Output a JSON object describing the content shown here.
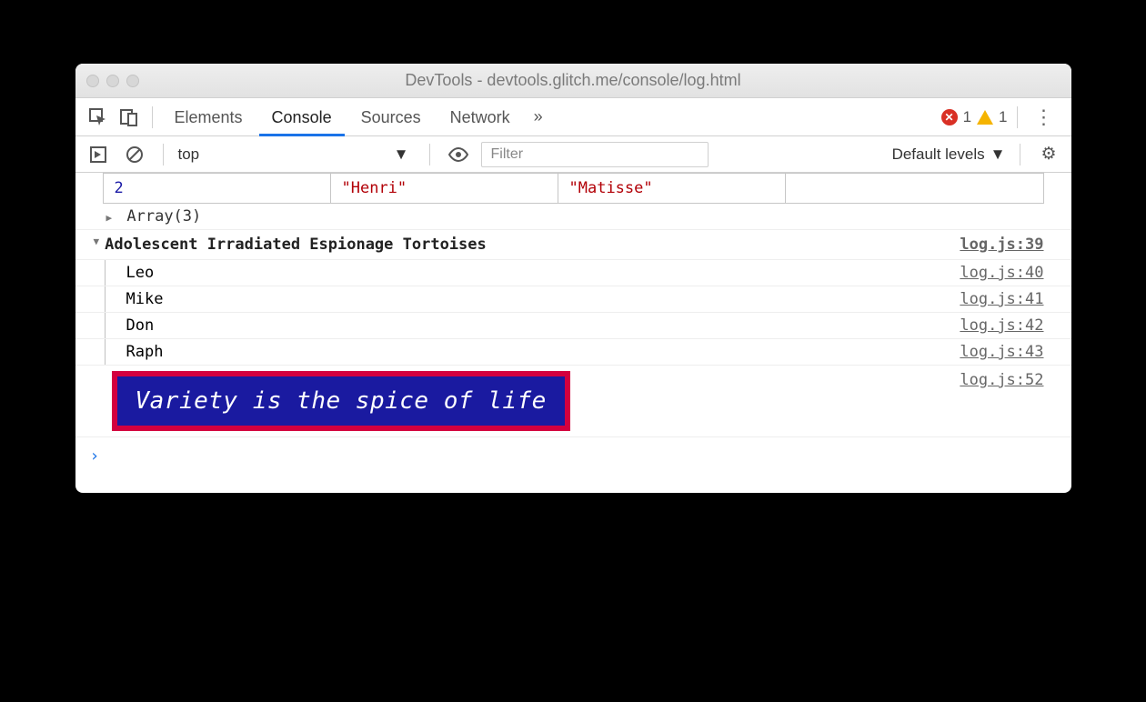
{
  "window": {
    "title": "DevTools - devtools.glitch.me/console/log.html"
  },
  "tabs": {
    "items": [
      "Elements",
      "Console",
      "Sources",
      "Network"
    ],
    "active": "Console",
    "more_glyph": "»"
  },
  "badges": {
    "error_count": "1",
    "warning_count": "1"
  },
  "toolbar": {
    "context": "top",
    "filter_placeholder": "Filter",
    "levels_label": "Default levels"
  },
  "console": {
    "table_row": {
      "index": "2",
      "first": "\"Henri\"",
      "last": "\"Matisse\""
    },
    "array_label": "Array(3)",
    "group": {
      "title": "Adolescent Irradiated Espionage Tortoises",
      "src": "log.js:39",
      "items": [
        {
          "label": "Leo",
          "src": "log.js:40"
        },
        {
          "label": "Mike",
          "src": "log.js:41"
        },
        {
          "label": "Don",
          "src": "log.js:42"
        },
        {
          "label": "Raph",
          "src": "log.js:43"
        }
      ]
    },
    "styled": {
      "text": "Variety is the spice of life",
      "src": "log.js:52"
    },
    "prompt_glyph": "›"
  }
}
